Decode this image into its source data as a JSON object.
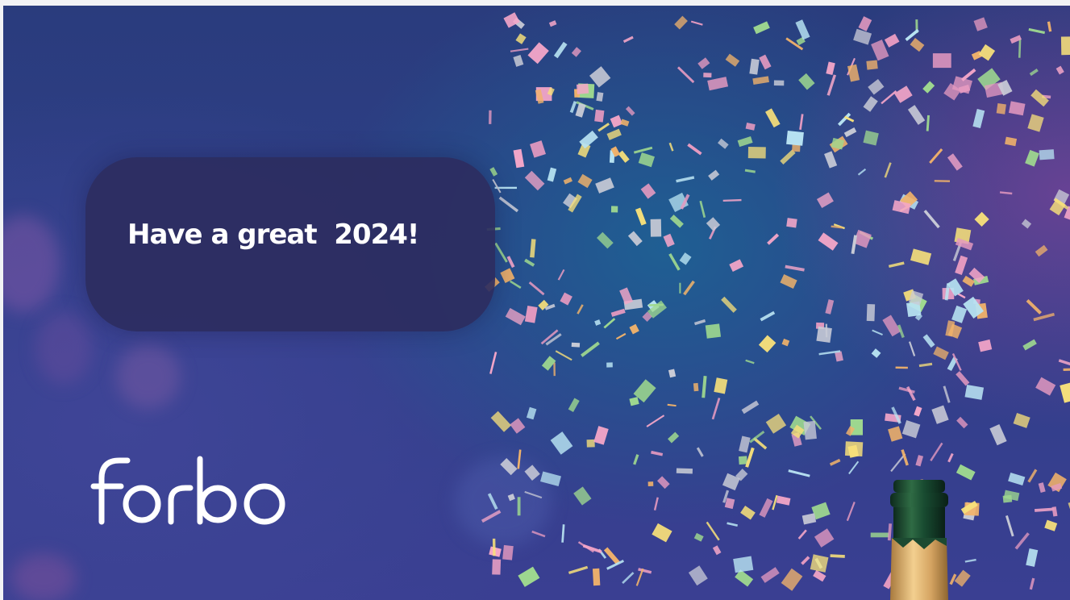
{
  "greeting": {
    "text": "Have a great  2024!"
  },
  "logo": {
    "name": "forbo"
  },
  "colors": {
    "background_deep": "#2f3f88",
    "background_teal": "#1f5f93",
    "card": "#2c2c60",
    "text": "#ffffff",
    "confetti": [
      "#f4a6c8",
      "#f7e07a",
      "#f2b36a",
      "#b8e3f2",
      "#9fd98f",
      "#c9cbd6",
      "#e59ac0"
    ]
  },
  "icons": [
    "forbo-logo",
    "confetti-decoration",
    "champagne-bottle-icon"
  ]
}
